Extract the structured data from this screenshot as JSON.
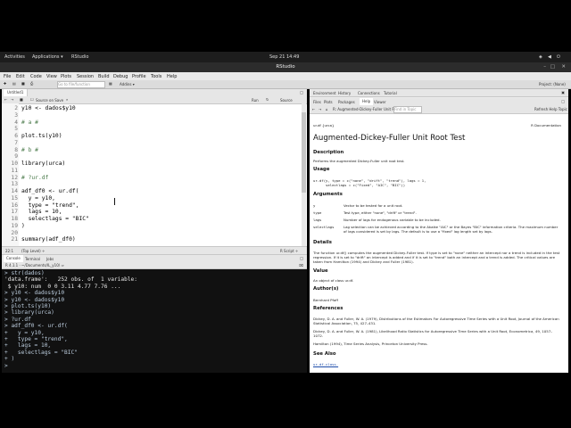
{
  "desktop": {
    "activities": "Activities",
    "applications": "Applications ▾",
    "app_name": "RStudio",
    "clock": "Sep 21  14:49"
  },
  "window": {
    "title": "RStudio"
  },
  "menu": [
    "File",
    "Edit",
    "Code",
    "View",
    "Plots",
    "Session",
    "Build",
    "Debug",
    "Profile",
    "Tools",
    "Help"
  ],
  "toolbar": {
    "goto_placeholder": "Go to file/function",
    "addins": "Addins ▾",
    "project": "Project: (None)"
  },
  "editor": {
    "tab_name": "Untitled1",
    "source_on_save": "Source on Save",
    "run": "Run",
    "source": "Source",
    "line_numbers": [
      "2",
      "3",
      "4",
      "5",
      "6",
      "7",
      "8",
      "9",
      "10",
      "11",
      "12",
      "13",
      "14",
      "15",
      "16",
      "17",
      "18",
      "19",
      "20",
      "21"
    ],
    "code": [
      "y10 <- dados$y10",
      "",
      "# a #",
      "",
      "plot.ts(y10)",
      "",
      "# b #",
      "",
      "library(urca)",
      "",
      "# ?ur.df",
      "",
      "adf_df0 <- ur.df(",
      "  y = y10,",
      "  type = \"trend\",",
      "  lags = 10,",
      "  selectlags = \"BIC\"",
      ")",
      "",
      "summary(adf_df0)"
    ],
    "status_pos": "22:1",
    "status_level": "(Top Level) ÷",
    "status_type": "R Script ÷"
  },
  "console": {
    "tabs": [
      "Console",
      "Terminal",
      "Jobs"
    ],
    "path": "R 4.1.1 · ~/Documents/IL_y10/ ⇒",
    "lines": [
      "> str(dados)",
      "'data.frame':   252 obs. of  1 variable:",
      " $ y10: num  0 0 3.11 4.77 7.76 ...",
      "> y10 <- dados$y10",
      "> y10 <- dados$y10",
      "> plot.ts(y10)",
      "> library(urca)",
      "> ?ur.df",
      "> adf_df0 <- ur.df(",
      "+   y = y10,",
      "+   type = \"trend\",",
      "+   lags = 10,",
      "+   selectlags = \"BIC\"",
      "+ )",
      ">"
    ]
  },
  "right_top_tabs": [
    "Environment",
    "History",
    "Connections",
    "Tutorial"
  ],
  "right_bottom_tabs": [
    "Files",
    "Plots",
    "Packages",
    "Help",
    "Viewer"
  ],
  "help": {
    "topic_dropdown": "R: Augmented-Dickey-Fuller Unit Root Test",
    "find_in_topic": "Find in Topic",
    "refresh_label": "Refresh Help Topic",
    "header_left": "ur.df {urca}",
    "header_right": "R Documentation",
    "title": "Augmented-Dickey-Fuller Unit Root Test",
    "description_h": "Description",
    "description": "Performs the augmented Dickey-Fuller unit root test.",
    "usage_h": "Usage",
    "usage_1": "ur.df(y, type = c(\"none\", \"drift\", \"trend\"), lags = 1,",
    "usage_2": "      selectlags = c(\"Fixed\", \"AIC\", \"BIC\"))",
    "arguments_h": "Arguments",
    "args": [
      {
        "name": "y",
        "desc": "Vector to be tested for a unit root."
      },
      {
        "name": "type",
        "desc": "Test type, either \"none\", \"drift\" or \"trend\"."
      },
      {
        "name": "lags",
        "desc": "Number of lags for endogenous variable to be included."
      },
      {
        "name": "selectlags",
        "desc": "Lag selection can be achieved according to the Akaike \"AIC\" or the Bayes \"BIC\" information criteria. The maximum number of lags considered is set by lags. The default is to use a \"fixed\" lag length set by lags."
      }
    ],
    "details_h": "Details",
    "details": "The function ur.df() computes the augmented Dickey-Fuller test. If type is set to \"none\" neither an intercept nor a trend is included in the test regression. If it is set to \"drift\" an intercept is added and if it is set to \"trend\" both an intercept and a trend is added. The critical values are taken from Hamilton (1994) and Dickey and Fuller (1981).",
    "value_h": "Value",
    "value": "An object of class ur.df.",
    "author_h": "Author(s)",
    "author": "Bernhard Pfaff",
    "references_h": "References",
    "ref1": "Dickey, D. A. and Fuller, W. A. (1979), Distributions of the Estimators For Autoregressive Time Series with a Unit Root, Journal of the American Statistical Association, 75, 427–431.",
    "ref2": "Dickey, D. A. and Fuller, W. A. (1981), Likelihood Ratio Statistics for Autoregressive Time Series with a Unit Root, Econometrica, 49, 1057–1072.",
    "ref3": "Hamilton (1994), Time Series Analysis, Princeton University Press.",
    "seealso_h": "See Also",
    "seealso": "ur.df-class."
  }
}
